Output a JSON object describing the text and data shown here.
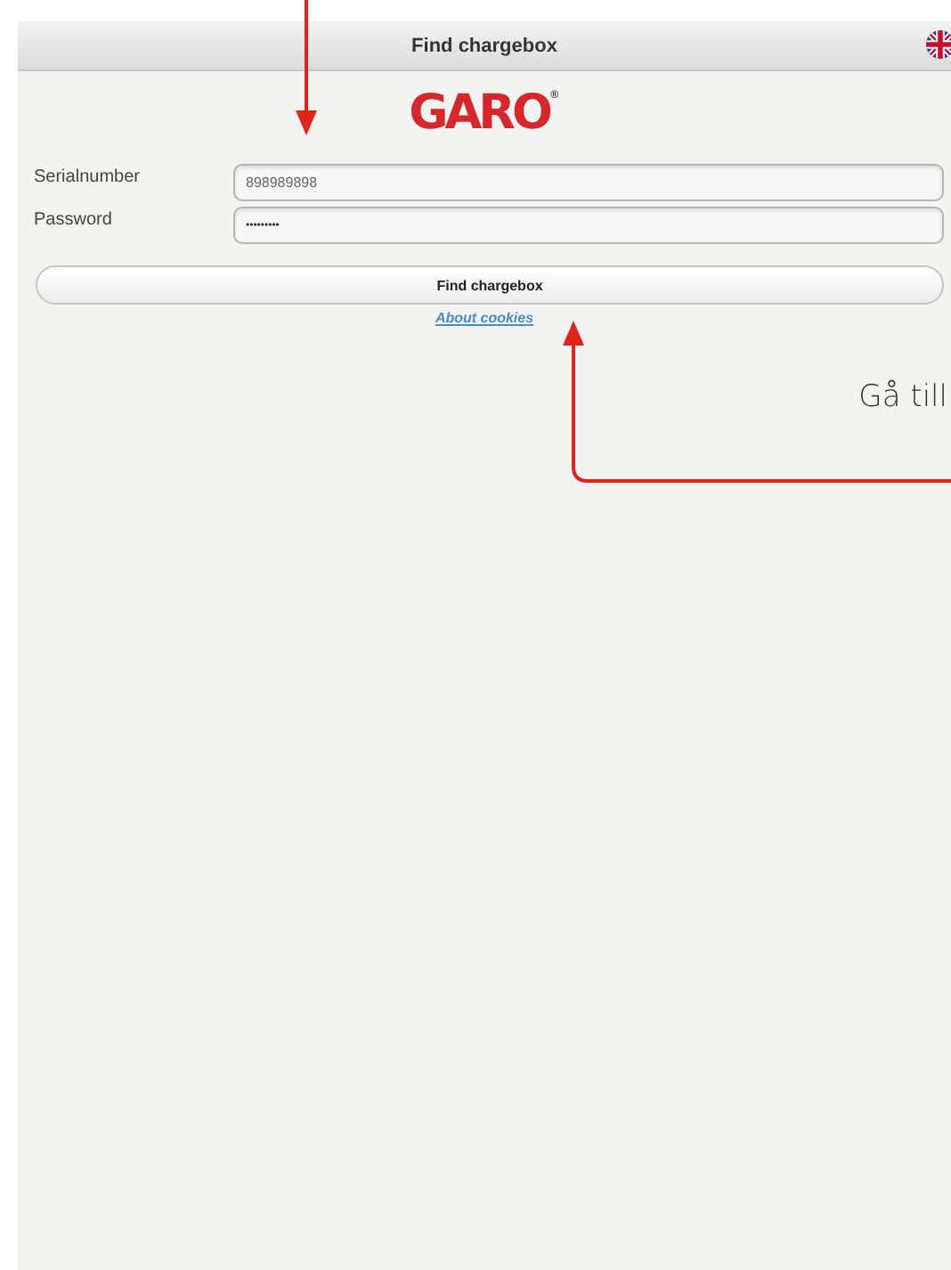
{
  "header": {
    "title": "Find chargebox"
  },
  "logo": {
    "text": "GARO$^{®}$"
  },
  "form": {
    "fields": [
      {
        "label": "Serialnumber",
        "value": "898989898",
        "kind": "text"
      },
      {
        "label": "Password",
        "value": "•••••••••",
        "kind": "password"
      }
    ],
    "button": "Find chargebox",
    "link": "About cookies"
  },
  "annotation": {
    "text": "Gå till"
  }
}
